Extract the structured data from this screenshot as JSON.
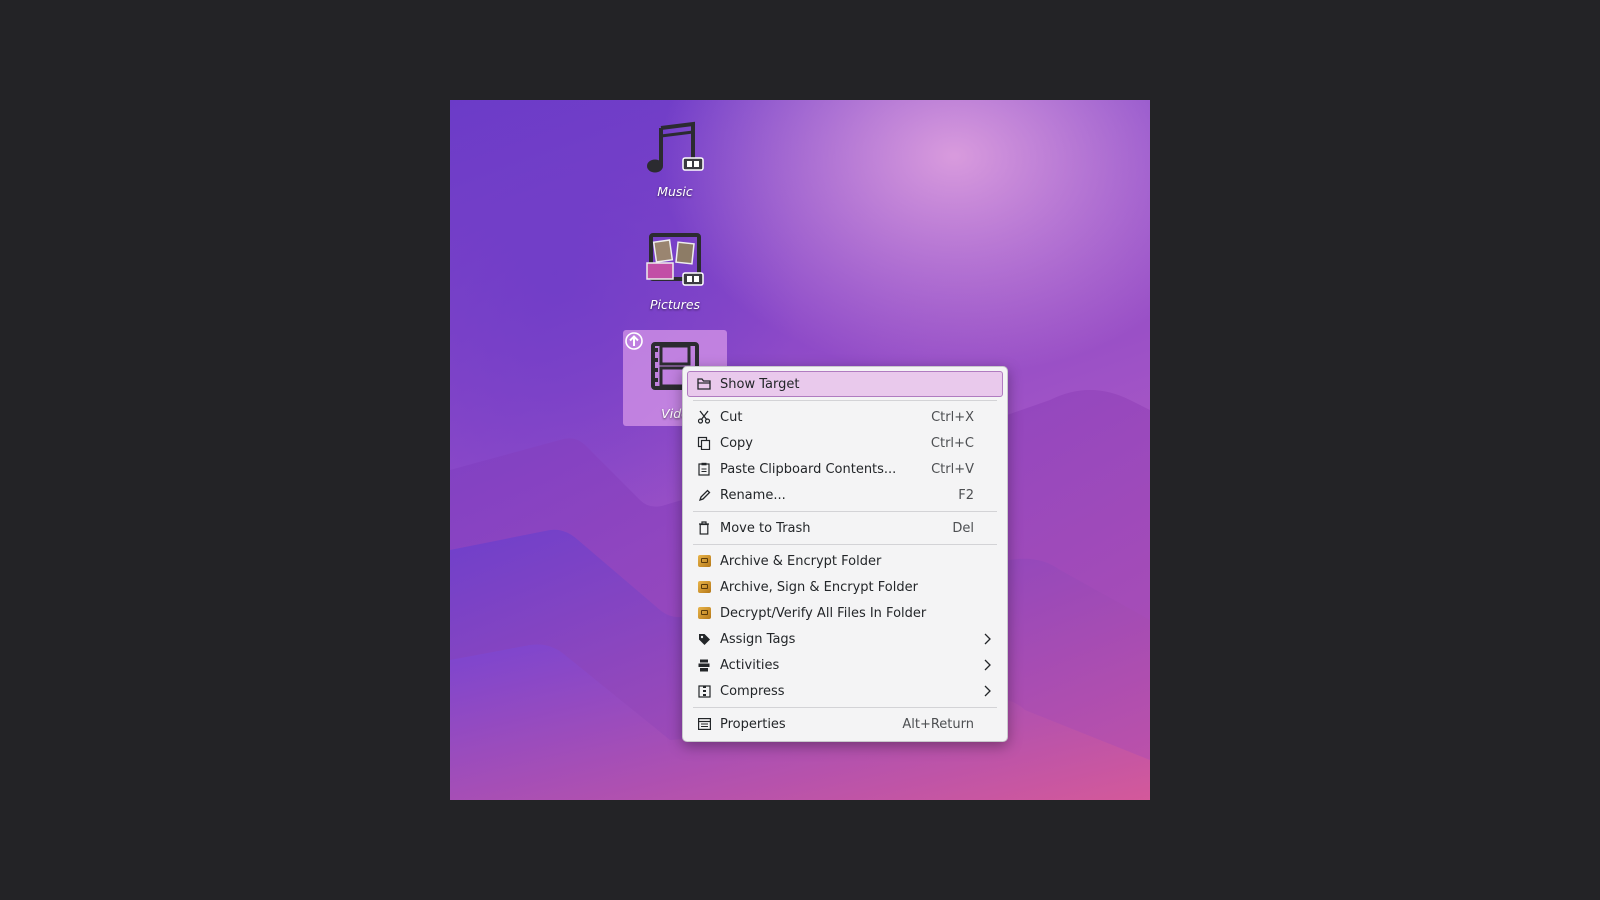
{
  "desktop": {
    "icons": [
      {
        "label": "Music",
        "icon": "music-folder-icon",
        "selected": false
      },
      {
        "label": "Pictures",
        "icon": "pictures-folder-icon",
        "selected": false
      },
      {
        "label": "Vide",
        "icon": "videos-folder-icon",
        "selected": true
      }
    ]
  },
  "menu": {
    "show_target": {
      "label": "Show Target",
      "icon": "folder-icon"
    },
    "cut": {
      "label": "Cut",
      "shortcut": "Ctrl+X",
      "icon": "scissors-icon"
    },
    "copy": {
      "label": "Copy",
      "shortcut": "Ctrl+C",
      "icon": "copy-icon"
    },
    "paste": {
      "label": "Paste Clipboard Contents...",
      "shortcut": "Ctrl+V",
      "icon": "clipboard-icon"
    },
    "rename": {
      "label": "Rename...",
      "shortcut": "F2",
      "icon": "pencil-icon"
    },
    "trash": {
      "label": "Move to Trash",
      "shortcut": "Del",
      "icon": "trash-icon"
    },
    "archive_encrypt": {
      "label": "Archive & Encrypt Folder",
      "icon": "kgpg-icon"
    },
    "archive_sign_encrypt": {
      "label": "Archive, Sign & Encrypt Folder",
      "icon": "kgpg-icon"
    },
    "decrypt_verify": {
      "label": "Decrypt/Verify All Files In Folder",
      "icon": "kgpg-icon"
    },
    "assign_tags": {
      "label": "Assign Tags",
      "icon": "tag-icon"
    },
    "activities": {
      "label": "Activities",
      "icon": "activities-icon"
    },
    "compress": {
      "label": "Compress",
      "icon": "compress-icon"
    },
    "properties": {
      "label": "Properties",
      "shortcut": "Alt+Return",
      "icon": "properties-icon"
    }
  },
  "colors": {
    "menu_bg": "#f4f4f5",
    "highlight": "#e9c9ec",
    "highlight_border": "#b07cc0",
    "selected_icon_bg": "#d696e8"
  }
}
